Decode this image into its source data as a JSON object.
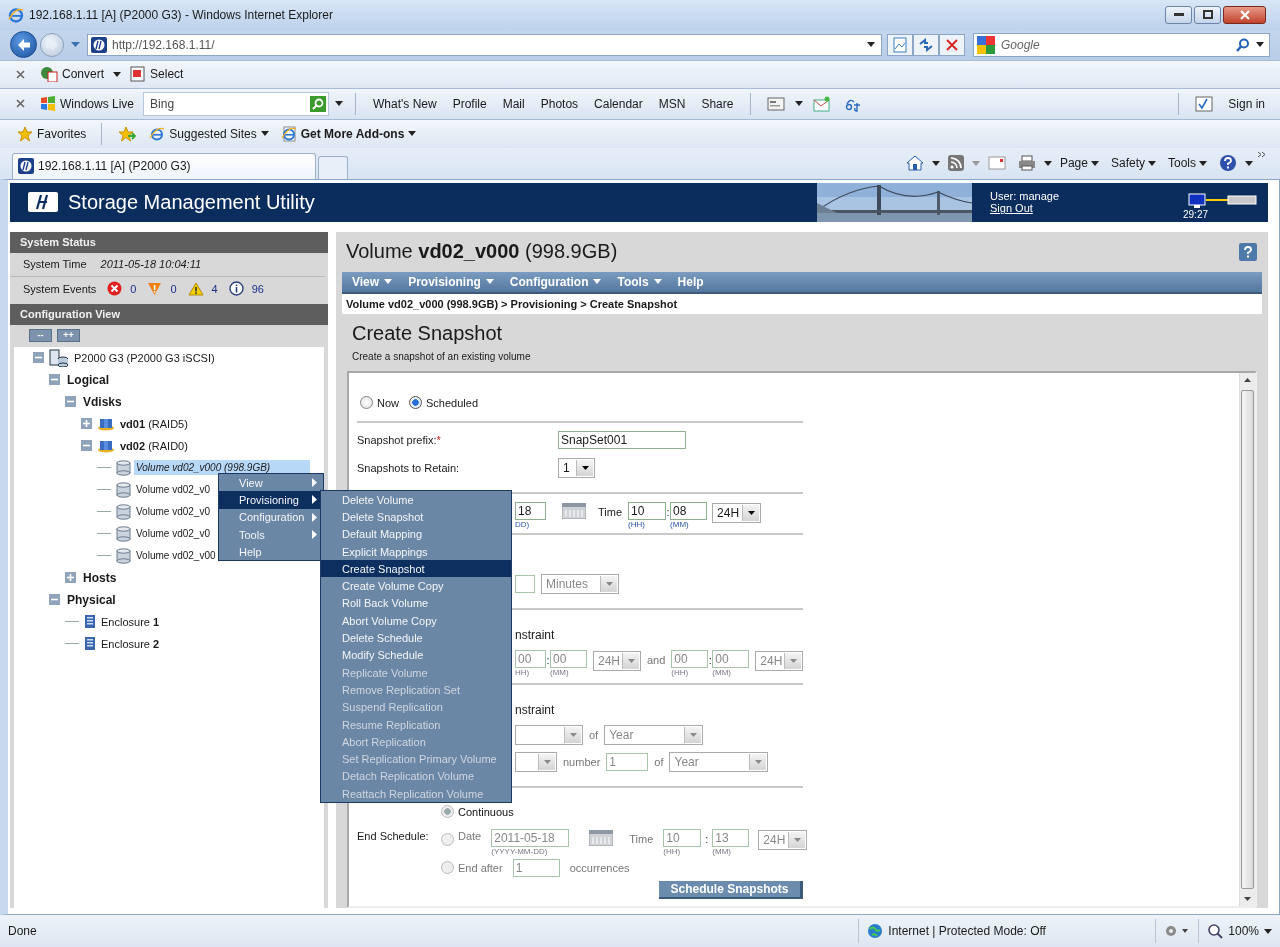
{
  "window": {
    "title": "192.168.1.11 [A] (P2000 G3) - Windows Internet Explorer"
  },
  "address_bar": {
    "url": "http://192.168.1.11/"
  },
  "search_box": {
    "placeholder": "Google"
  },
  "convert_bar": {
    "items": [
      "Convert",
      "Select"
    ]
  },
  "windows_live_bar": {
    "brand": "Windows Live",
    "search_value": "Bing",
    "links": [
      "What's New",
      "Profile",
      "Mail",
      "Photos",
      "Calendar",
      "MSN",
      "Share"
    ],
    "sign_in": "Sign in"
  },
  "favorites_bar": {
    "favorites": "Favorites",
    "items": [
      {
        "label": "Suggested Sites",
        "bold": false
      },
      {
        "label": "Get More Add-ons",
        "bold": true
      }
    ]
  },
  "tabs": [
    {
      "label": "192.168.1.11 [A] (P2000 G3)",
      "selected": true
    }
  ],
  "command_bar": [
    "Page",
    "Safety",
    "Tools"
  ],
  "banner": {
    "title": "Storage Management Utility",
    "user": "User: manage",
    "sign_out": "Sign Out",
    "session_time": "29:27"
  },
  "system_status": {
    "title": "System Status",
    "time_label": "System Time",
    "time_value": "2011-05-18 10:04:11",
    "events_label": "System Events",
    "events": [
      {
        "kind": "critical",
        "count": "0"
      },
      {
        "kind": "error",
        "count": "0"
      },
      {
        "kind": "warning",
        "count": "4"
      },
      {
        "kind": "info",
        "count": "96"
      }
    ]
  },
  "configuration_view": {
    "title": "Configuration View",
    "collapse": "--",
    "expand": "++",
    "tree": [
      {
        "label": "P2000 G3 (P2000 G3 iSCSI)",
        "kind": "system",
        "expanded": true,
        "selected": false,
        "children": [
          {
            "label": "Logical",
            "kind": "group",
            "expanded": true,
            "selected": false,
            "children": [
              {
                "label": "Vdisks",
                "kind": "group",
                "expanded": true,
                "selected": false,
                "children": [
                  {
                    "label": "**vd01** (RAID5)",
                    "kind": "vdisk",
                    "expanded": false,
                    "selected": false
                  },
                  {
                    "label": "**vd02** (RAID0)",
                    "kind": "vdisk",
                    "expanded": true,
                    "selected": false,
                    "children": [
                      {
                        "label": "Volume vd02_v000 (998.9GB)",
                        "kind": "volume",
                        "selected": true
                      },
                      {
                        "label": "Volume vd02_v0",
                        "kind": "volume",
                        "selected": false
                      },
                      {
                        "label": "Volume vd02_v0",
                        "kind": "volume",
                        "selected": false
                      },
                      {
                        "label": "Volume vd02_v0",
                        "kind": "volume",
                        "selected": false
                      },
                      {
                        "label": "Volume vd02_v00",
                        "kind": "volume",
                        "selected": false
                      }
                    ]
                  }
                ]
              },
              {
                "label": "Hosts",
                "kind": "group",
                "expanded": false,
                "selected": false
              }
            ]
          },
          {
            "label": "Physical",
            "kind": "group",
            "expanded": true,
            "selected": false,
            "children": [
              {
                "label": "Enclosure **1**",
                "kind": "enclosure",
                "selected": false
              },
              {
                "label": "Enclosure **2**",
                "kind": "enclosure",
                "selected": false
              }
            ]
          }
        ]
      }
    ]
  },
  "content": {
    "title": "Volume **vd02_v000** (998.9GB)",
    "menu": [
      {
        "label": "View",
        "has_menu": true
      },
      {
        "label": "Provisioning",
        "has_menu": true
      },
      {
        "label": "Configuration",
        "has_menu": true
      },
      {
        "label": "Tools",
        "has_menu": true
      },
      {
        "label": "Help",
        "has_menu": false
      }
    ],
    "breadcrumb": "Volume vd02_v000 (998.9GB) > Provisioning > Create Snapshot",
    "heading": "Create Snapshot",
    "subtitle": "Create a snapshot of an existing volume"
  },
  "form": {
    "mode": [
      {
        "label": "Now",
        "selected": false
      },
      {
        "label": "Scheduled",
        "selected": true
      }
    ],
    "prefix": {
      "label": "Snapshot prefix:",
      "required_mark": "*",
      "value": "SnapSet001"
    },
    "retain": {
      "label": "Snapshots to Retain:",
      "value": "1"
    },
    "start": {
      "date_value": "18",
      "date_hint": "DD)",
      "time_label": "Time",
      "hour": "10",
      "hour_hint": "(HH)",
      "separator": ":",
      "minute": "08",
      "minute_hint": "(MM)",
      "clock": "24H"
    },
    "interval": {
      "unit": "Minutes",
      "disabled": true
    },
    "time_constraint": {
      "label": "nstraint",
      "from_hour": "00",
      "from_hour_hint": "HH)",
      "separator": ":",
      "from_minute": "00",
      "from_minute_hint": "(MM)",
      "from_clock": "24H",
      "and": "and",
      "to_hour": "00",
      "to_hour_hint": "(HH)",
      "to_separator": ":",
      "to_minute": "00",
      "to_minute_hint": "(MM)",
      "to_clock": "24H",
      "disabled": true
    },
    "date_constraint": {
      "label": "nstraint",
      "of_1": "of",
      "period_1": "Year",
      "number_label": "number",
      "number": "1",
      "of_2": "of",
      "period_2": "Year",
      "disabled": true
    },
    "end": {
      "label": "End Schedule:",
      "options": [
        {
          "kind": "continuous",
          "label": "Continuous",
          "selected": true
        },
        {
          "kind": "date",
          "label": "Date",
          "selected": false
        },
        {
          "kind": "after",
          "label": "End after",
          "selected": false
        }
      ],
      "date": "2011-05-18",
      "date_hint": "(YYYY-MM-DD)",
      "time_label": "Time",
      "hour": "10",
      "hour_hint": "(HH)",
      "separator": ":",
      "minute": "13",
      "minute_hint": "(MM)",
      "clock": "24H",
      "count": "1",
      "count_suffix": "occurrences",
      "disabled": true
    },
    "submit": "Schedule Snapshots"
  },
  "context_menu": {
    "items": [
      {
        "label": "View",
        "has_submenu": true,
        "selected": false
      },
      {
        "label": "Provisioning",
        "has_submenu": true,
        "selected": true
      },
      {
        "label": "Configuration",
        "has_submenu": true,
        "selected": false
      },
      {
        "label": "Tools",
        "has_submenu": true,
        "selected": false
      },
      {
        "label": "Help",
        "has_submenu": false,
        "selected": false
      }
    ],
    "submenu": [
      {
        "label": "Delete Volume",
        "selected": false,
        "disabled": false
      },
      {
        "label": "Delete Snapshot",
        "selected": false,
        "disabled": false
      },
      {
        "label": "Default Mapping",
        "selected": false,
        "disabled": false
      },
      {
        "label": "Explicit Mappings",
        "selected": false,
        "disabled": false
      },
      {
        "label": "Create Snapshot",
        "selected": true,
        "disabled": false
      },
      {
        "label": "Create Volume Copy",
        "selected": false,
        "disabled": false
      },
      {
        "label": "Roll Back Volume",
        "selected": false,
        "disabled": false
      },
      {
        "label": "Abort Volume Copy",
        "selected": false,
        "disabled": false
      },
      {
        "label": "Delete Schedule",
        "selected": false,
        "disabled": false
      },
      {
        "label": "Modify Schedule",
        "selected": false,
        "disabled": false
      },
      {
        "label": "Replicate Volume",
        "selected": false,
        "disabled": true
      },
      {
        "label": "Remove Replication Set",
        "selected": false,
        "disabled": true
      },
      {
        "label": "Suspend Replication",
        "selected": false,
        "disabled": true
      },
      {
        "label": "Resume Replication",
        "selected": false,
        "disabled": true
      },
      {
        "label": "Abort Replication",
        "selected": false,
        "disabled": true
      },
      {
        "label": "Set Replication Primary Volume",
        "selected": false,
        "disabled": true
      },
      {
        "label": "Detach Replication Volume",
        "selected": false,
        "disabled": true
      },
      {
        "label": "Reattach Replication Volume",
        "selected": false,
        "disabled": true
      }
    ]
  },
  "status_bar": {
    "text": "Done",
    "zone": "Internet | Protected Mode: Off",
    "zoom": "100%"
  }
}
